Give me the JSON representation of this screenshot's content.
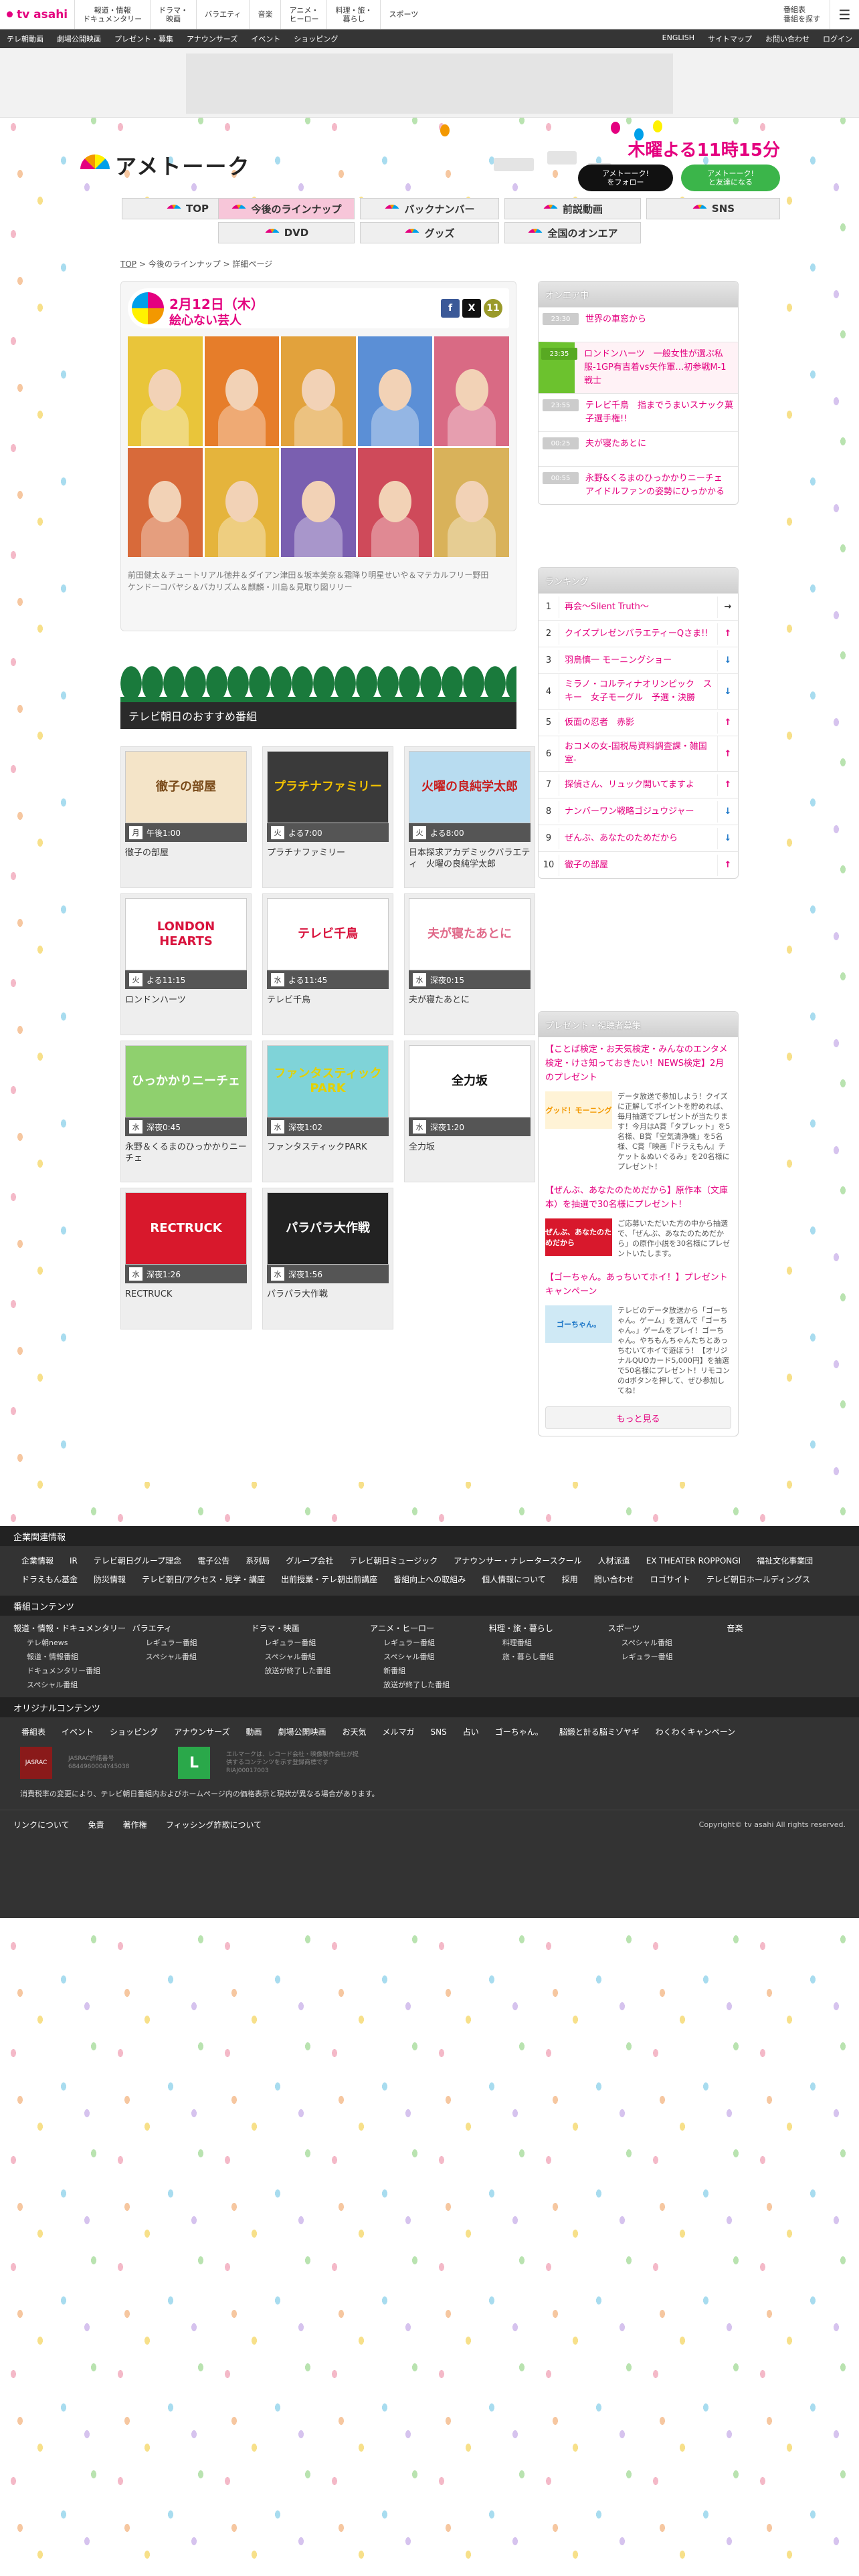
{
  "site": {
    "logo": "tv asahi"
  },
  "gnav": [
    "報道・情報\nドキュメンタリー",
    "ドラマ・\n映画",
    "バラエティ",
    "音楽",
    "アニメ・\nヒーロー",
    "料理・旅・\n暮らし",
    "スポーツ"
  ],
  "topright": {
    "program_table": "番組表\n番組を探す"
  },
  "subnav": {
    "left": [
      "テレ朝動画",
      "劇場公開映画",
      "プレゼント・募集",
      "アナウンサーズ",
      "イベント",
      "ショッピング"
    ],
    "right": [
      "ENGLISH",
      "サイトマップ",
      "お問い合わせ",
      "ログイン"
    ]
  },
  "header": {
    "title": "アメトーーク",
    "onair": "木曜よる11時15分",
    "x_follow": "アメトーーク!\nをフォロー",
    "line_friend": "アメトーーク!\nと友達になる"
  },
  "tabs": [
    "TOP",
    "今後のラインナップ",
    "バックナンバー",
    "前説動画",
    "DVD",
    "グッズ",
    "全国のオンエア",
    "SNS"
  ],
  "breadcrumb": {
    "top": "TOP",
    "lineup": "今後のラインナップ",
    "current": "詳細ページ"
  },
  "feature": {
    "date": "2月12日（木）",
    "title": "絵心ない芸人",
    "share_fb": "f",
    "share_x": "X",
    "share_count": "11",
    "cast_line1": "前田健太＆チュートリアル徳井＆ダイアン津田＆坂本美奈＆霜降り明星せいや＆マテカルフリー野田",
    "cast_line2": "ケンドーコバヤシ＆バカリズム＆麒麟・川島＆見取り図リリー"
  },
  "recommend": {
    "title": "テレビ朝日のおすすめ番組",
    "programs": [
      {
        "logo": "徹子の部屋",
        "day": "月",
        "time": "午後1:00",
        "name": "徹子の部屋",
        "bg": "#f4e4c8",
        "fg": "#7a4b1a"
      },
      {
        "logo": "プラチナファミリー",
        "day": "火",
        "time": "よる7:00",
        "name": "プラチナファミリー",
        "bg": "#3a3a3a",
        "fg": "#f2c200"
      },
      {
        "logo": "火曜の良純学太郎",
        "day": "火",
        "time": "よる8:00",
        "name": "日本探求アカデミックバラエティ　火曜の良純学太郎",
        "bg": "#b8dcf0",
        "fg": "#c81e1e"
      },
      {
        "logo": "LONDON HEARTS",
        "day": "火",
        "time": "よる11:15",
        "name": "ロンドンハーツ",
        "bg": "#fff",
        "fg": "#d8123c"
      },
      {
        "logo": "テレビ千鳥",
        "day": "水",
        "time": "よる11:45",
        "name": "テレビ千鳥",
        "bg": "#fff",
        "fg": "#d8123c"
      },
      {
        "logo": "夫が寝たあとに",
        "day": "水",
        "time": "深夜0:15",
        "name": "夫が寝たあとに",
        "bg": "#fff",
        "fg": "#e06a8a"
      },
      {
        "logo": "ひっかかりニーチェ",
        "day": "水",
        "time": "深夜0:45",
        "name": "永野＆くるまのひっかかりニーチェ",
        "bg": "#8fd06e",
        "fg": "#fff"
      },
      {
        "logo": "ファンタスティックPARK",
        "day": "水",
        "time": "深夜1:02",
        "name": "ファンタスティックPARK",
        "bg": "#7fd3d8",
        "fg": "#e4d100"
      },
      {
        "logo": "全力坂",
        "day": "水",
        "time": "深夜1:20",
        "name": "全力坂",
        "bg": "#fff",
        "fg": "#111"
      },
      {
        "logo": "RECTRUCK",
        "day": "水",
        "time": "深夜1:26",
        "name": "RECTRUCK",
        "bg": "#d8182c",
        "fg": "#fff"
      },
      {
        "logo": "パラパラ大作戦",
        "day": "水",
        "time": "深夜1:56",
        "name": "パラパラ大作戦",
        "bg": "#222",
        "fg": "#fff"
      }
    ]
  },
  "onair": {
    "title": "オンエア中",
    "items": [
      {
        "time": "23:30",
        "name": "世界の車窓から",
        "live": false
      },
      {
        "time": "23:35",
        "name": "ロンドンハーツ　一般女性が選ぶ私服-1GP有吉着vs矢作軍…初参戦M-1戦士",
        "live": true
      },
      {
        "time": "23:55",
        "name": "テレビ千鳥　指までうまいスナック菓子選手権!!",
        "live": false
      },
      {
        "time": "00:25",
        "name": "夫が寝たあとに",
        "live": false
      },
      {
        "time": "00:55",
        "name": "永野&くるまのひっかかりニーチェ　アイドルファンの姿勢にひっかかる",
        "live": false
      }
    ]
  },
  "ranking": {
    "title": "ランキング",
    "items": [
      {
        "no": "1",
        "name": "再会〜Silent Truth〜",
        "arrow": "→",
        "color": "#333"
      },
      {
        "no": "2",
        "name": "クイズプレゼンバラエティーQさま!!",
        "arrow": "↑",
        "color": "#e4007f"
      },
      {
        "no": "3",
        "name": "羽鳥慎一 モーニングショー",
        "arrow": "↓",
        "color": "#1e78c8"
      },
      {
        "no": "4",
        "name": "ミラノ・コルティナオリンピック　スキー　女子モーグル　予選・決勝",
        "arrow": "↓",
        "color": "#1e78c8"
      },
      {
        "no": "5",
        "name": "仮面の忍者　赤影",
        "arrow": "↑",
        "color": "#e4007f"
      },
      {
        "no": "6",
        "name": "おコメの女-国税局資料調査課・雑国室-",
        "arrow": "↑",
        "color": "#e4007f"
      },
      {
        "no": "7",
        "name": "探偵さん、リュック開いてますよ",
        "arrow": "↑",
        "color": "#e4007f"
      },
      {
        "no": "8",
        "name": "ナンバーワン戦略ゴジュウジャー",
        "arrow": "↓",
        "color": "#1e78c8"
      },
      {
        "no": "9",
        "name": "ぜんぶ、あなたのためだから",
        "arrow": "↓",
        "color": "#1e78c8"
      },
      {
        "no": "10",
        "name": "徹子の部屋",
        "arrow": "↑",
        "color": "#e4007f"
      }
    ]
  },
  "present": {
    "title": "プレゼント・視聴者募集",
    "items": [
      {
        "title": "【ことば検定・お天気検定・みんなのエンタメ検定・けさ知っておきたい！NEWS検定】2月のプレゼント",
        "img": "グッド！モーニング",
        "img_bg": "#fff3d6",
        "img_fg": "#f39800",
        "text": "データ放送で参加しよう！クイズに正解してポイントを貯めれば、毎月抽選でプレゼントが当たります！今月はA賞「タブレット」を5名様、B賞「空気清浄機」を5名様、C賞「映画『ドラえもん』チケット＆ぬいぐるみ」を20名様にプレゼント！"
      },
      {
        "title": "【ぜんぶ、あなたのためだから】原作本（文庫本）を抽選で30名様にプレゼント！",
        "img": "ぜんぶ、あなたのためだから",
        "img_bg": "#d8182c",
        "img_fg": "#fff",
        "text": "ご応募いただいた方の中から抽選で、「ぜんぶ、あなたのためだから」の原作小説を30名様にプレゼントいたします。"
      },
      {
        "title": "【ゴーちゃん。あっちいてホイ！】プレゼントキャンペーン",
        "img": "ゴーちゃん。",
        "img_bg": "#cfe9f5",
        "img_fg": "#1e78c8",
        "text": "テレビのデータ放送から「ゴーちゃん。ゲーム」を選んで「ゴーちゃん。」ゲームをプレイ！ゴーちゃん。やちもんちゃんたちとあっちむいてホイで遊ぼう！【オリジナルQUOカード5,000円】を抽選で50名様にプレゼント！リモコンのdボタンを押して、ぜひ参加してね！"
      }
    ],
    "more": "もっと見る"
  },
  "footer": {
    "corp_title": "企業関連情報",
    "corp_links": [
      "企業情報",
      "IR",
      "テレビ朝日グループ理念",
      "電子公告",
      "系列局",
      "グループ会社",
      "テレビ朝日ミュージック",
      "アナウンサー・ナレータースクール",
      "人材派遣",
      "EX THEATER ROPPONGI",
      "福祉文化事業団",
      "ドラえもん基金",
      "防災情報",
      "テレビ朝日/アクセス・見学・講座",
      "出前授業・テレ朝出前講座",
      "番組向上への取組み",
      "個人情報について",
      "採用",
      "問い合わせ",
      "ロゴサイト",
      "テレビ朝日ホールディングス"
    ],
    "prog_title": "番組コンテンツ",
    "prog_cols": [
      {
        "title": "報道・情報・ドキュメンタリー",
        "items": [
          "テレ朝news",
          "報道・情報番組",
          "ドキュメンタリー番組",
          "スペシャル番組"
        ]
      },
      {
        "title": "バラエティ",
        "items": [
          "レギュラー番組",
          "スペシャル番組"
        ]
      },
      {
        "title": "ドラマ・映画",
        "items": [
          "レギュラー番組",
          "スペシャル番組",
          "放送が終了した番組"
        ]
      },
      {
        "title": "アニメ・ヒーロー",
        "items": [
          "レギュラー番組",
          "スペシャル番組",
          "新番組",
          "放送が終了した番組"
        ]
      },
      {
        "title": "料理・旅・暮らし",
        "items": [
          "料理番組",
          "旅・暮らし番組"
        ]
      },
      {
        "title": "スポーツ",
        "items": [
          "スペシャル番組",
          "レギュラー番組"
        ]
      },
      {
        "title": "音楽",
        "items": []
      }
    ],
    "orig_title": "オリジナルコンテンツ",
    "orig_links": [
      "番組表",
      "イベント",
      "ショッピング",
      "アナウンサーズ",
      "動画",
      "劇場公開映画",
      "お天気",
      "メルマガ",
      "SNS",
      "占い",
      "ゴーちゃん。",
      "脳鍛と計る脳ミゾヤギ",
      "わくわくキャンペーン"
    ],
    "badge1": "JASRAC",
    "badge1_note": "JASRAC許諾番号 6844960004Y45038",
    "badge2": "L",
    "badge2_note": "エルマークは、レコード会社・映像製作会社が提供するコンテンツを示す登録商標です RIAJ00017003",
    "notice": "消費税率の変更により、テレビ朝日番組内およびホームページ内の価格表示と現状が異なる場合があります。",
    "bottom_links": [
      "リンクについて",
      "免責",
      "著作権",
      "フィッシング詐欺について"
    ],
    "copyright": "Copyright© tv asahi All rights reserved."
  }
}
